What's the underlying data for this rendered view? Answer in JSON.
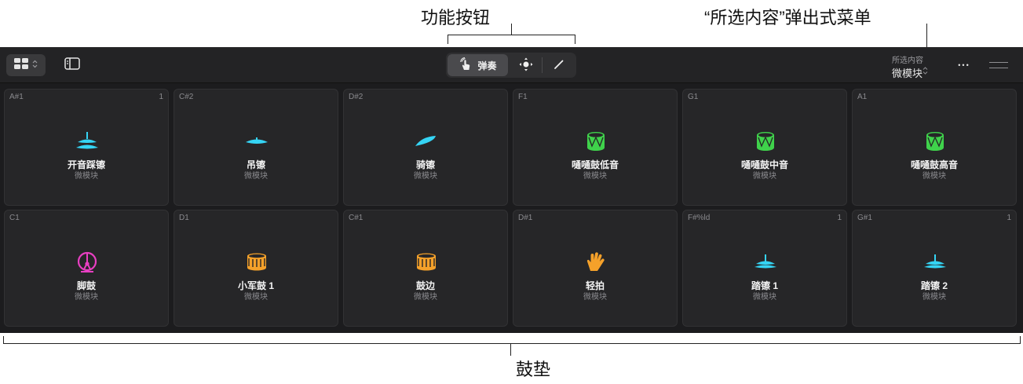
{
  "callouts": {
    "function_buttons": "功能按钮",
    "selection_popup": "“所选内容”弹出式菜单",
    "drum_pads": "鼓垫"
  },
  "toolbar": {
    "play_label": "弹奏",
    "selection_label": "所选内容",
    "selection_value": "微模块",
    "more": "•••"
  },
  "pads": [
    {
      "note": "A#1",
      "count": "1",
      "name": "开音踩镲",
      "type": "微模块",
      "icon": "open-hihat-icon",
      "color": "#35d4f4"
    },
    {
      "note": "C#2",
      "count": "",
      "name": "吊镲",
      "type": "微模块",
      "icon": "crash-cymbal-icon",
      "color": "#35d4f4"
    },
    {
      "note": "D#2",
      "count": "",
      "name": "骑镲",
      "type": "微模块",
      "icon": "ride-cymbal-icon",
      "color": "#35d4f4"
    },
    {
      "note": "F1",
      "count": "",
      "name": "嗵嗵鼓低音",
      "type": "微模块",
      "icon": "tom-drum-icon",
      "color": "#3fd24b"
    },
    {
      "note": "G1",
      "count": "",
      "name": "嗵嗵鼓中音",
      "type": "微模块",
      "icon": "tom-drum-icon",
      "color": "#3fd24b"
    },
    {
      "note": "A1",
      "count": "",
      "name": "嗵嗵鼓高音",
      "type": "微模块",
      "icon": "tom-drum-icon",
      "color": "#3fd24b"
    },
    {
      "note": "C1",
      "count": "",
      "name": "脚鼓",
      "type": "微模块",
      "icon": "kick-drum-icon",
      "color": "#e83fc2"
    },
    {
      "note": "D1",
      "count": "",
      "name": "小军鼓 1",
      "type": "微模块",
      "icon": "snare-drum-icon",
      "color": "#f5a12a"
    },
    {
      "note": "C#1",
      "count": "",
      "name": "鼓边",
      "type": "微模块",
      "icon": "snare-drum-icon",
      "color": "#f5a12a"
    },
    {
      "note": "D#1",
      "count": "",
      "name": "轻拍",
      "type": "微模块",
      "icon": "hand-clap-icon",
      "color": "#f5a12a"
    },
    {
      "note": "F#%ld",
      "count": "1",
      "name": "踏镲 1",
      "type": "微模块",
      "icon": "pedal-hihat-icon",
      "color": "#35d4f4"
    },
    {
      "note": "G#1",
      "count": "1",
      "name": "踏镲 2",
      "type": "微模块",
      "icon": "pedal-hihat-icon",
      "color": "#35d4f4"
    }
  ]
}
